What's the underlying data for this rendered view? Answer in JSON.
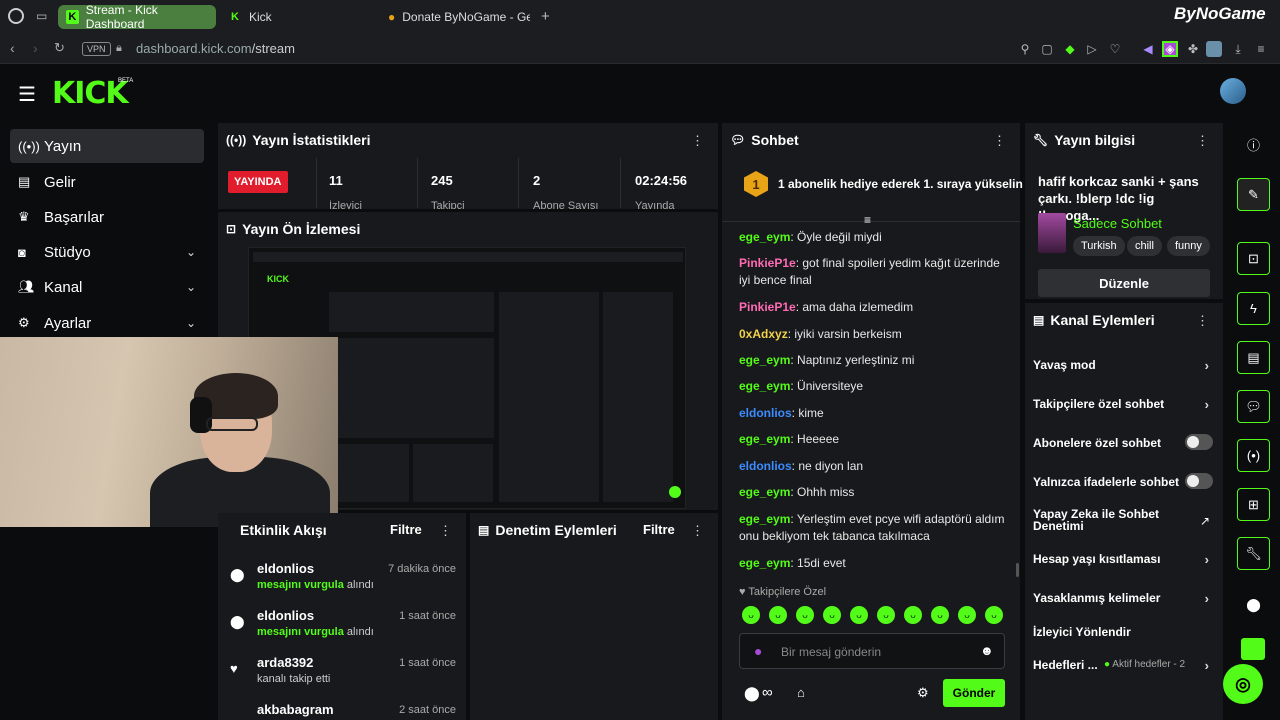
{
  "browser": {
    "tabs": [
      {
        "label": "Stream - Kick Dashboard"
      },
      {
        "label": "Kick"
      },
      {
        "label": "Donate ByNoGame - Gele"
      }
    ],
    "new_tab": "+",
    "url_host": "dashboard.kick.com",
    "url_path": "/stream",
    "vpn": "VPN"
  },
  "watermark": "ByNoGame",
  "header": {
    "logo": "KICK",
    "beta": "BETA"
  },
  "sidebar": {
    "items": [
      {
        "label": "Yayın",
        "icon": "broadcast-icon"
      },
      {
        "label": "Gelir",
        "icon": "chart-icon"
      },
      {
        "label": "Başarılar",
        "icon": "trophy-icon"
      },
      {
        "label": "Stüdyo",
        "icon": "studio-icon"
      },
      {
        "label": "Kanal",
        "icon": "users-icon"
      },
      {
        "label": "Ayarlar",
        "icon": "gear-icon"
      }
    ]
  },
  "stats": {
    "title": "Yayın İstatistikleri",
    "live_badge": "YAYINDA",
    "items": [
      {
        "value": "11",
        "label": "İzleyici"
      },
      {
        "value": "245",
        "label": "Takipçi"
      },
      {
        "value": "2",
        "label": "Abone Sayısı"
      },
      {
        "value": "02:24:56",
        "label": "Yayında"
      }
    ]
  },
  "preview": {
    "title": "Yayın Ön İzlemesi"
  },
  "activity": {
    "title": "Etkinlik Akışı",
    "filter": "Filtre",
    "items": [
      {
        "name": "eldonlios",
        "time": "7 dakika önce",
        "highlight": "mesajını vurgula",
        "rest": " alındı"
      },
      {
        "name": "eldonlios",
        "time": "1 saat önce",
        "highlight": "mesajını vurgula",
        "rest": " alındı"
      },
      {
        "name": "arda8392",
        "time": "1 saat önce",
        "highlight": "",
        "rest": "kanalı takip etti"
      },
      {
        "name": "akbabagram",
        "time": "2 saat önce",
        "highlight": "",
        "rest": ""
      }
    ]
  },
  "moderation": {
    "title": "Denetim Eylemleri",
    "filter": "Filtre"
  },
  "chat": {
    "title": "Sohbet",
    "pinned": "1 abonelik hediye ederek 1. sıraya yükselin",
    "pinned_rank": "1",
    "messages": [
      {
        "user": "ege_eym",
        "color": "#53fc18",
        "text": "Öyle değil miydi"
      },
      {
        "user": "PinkieP1e",
        "color": "#ff6bb5",
        "text": "got final spoileri yedim kağıt üzerinde iyi bence final"
      },
      {
        "user": "PinkieP1e",
        "color": "#ff6bb5",
        "text": "ama daha izlemedim"
      },
      {
        "user": "0xAdxyz",
        "color": "#f2d14a",
        "text": "iyiki varsin berkeism"
      },
      {
        "user": "ege_eym",
        "color": "#53fc18",
        "text": "Naptınız yerleştiniz mi"
      },
      {
        "user": "ege_eym",
        "color": "#53fc18",
        "text": "Üniversiteye"
      },
      {
        "user": "eldonlios",
        "color": "#3b8cff",
        "text": "kime"
      },
      {
        "user": "ege_eym",
        "color": "#53fc18",
        "text": "Heeeee"
      },
      {
        "user": "eldonlios",
        "color": "#3b8cff",
        "text": "ne diyon lan"
      },
      {
        "user": "ege_eym",
        "color": "#53fc18",
        "text": "Ohhh miss"
      },
      {
        "user": "ege_eym",
        "color": "#53fc18",
        "text": "Yerleştim evet pcye wifi adaptörü aldım onu bekliyom tek tabanca takılmaca"
      },
      {
        "user": "ege_eym",
        "color": "#53fc18",
        "text": "15di evet"
      }
    ],
    "followers_only": "Takipçilere Özel",
    "input_placeholder": "Bir mesaj gönderin",
    "send": "Gönder",
    "infinity": "∞"
  },
  "stream_info": {
    "title": "Yayın bilgisi",
    "stream_title": "hafif korkcaz sanki + şans çarkı. !blerp !dc !ig !bynoga...",
    "category": "Sadece Sohbet",
    "tags": [
      "Turkish",
      "chill",
      "funny"
    ],
    "edit": "Düzenle"
  },
  "channel_actions": {
    "title": "Kanal Eylemleri",
    "items": [
      {
        "label": "Yavaş mod",
        "kind": "chevron"
      },
      {
        "label": "Takipçilere özel sohbet",
        "kind": "chevron"
      },
      {
        "label": "Abonelere özel sohbet",
        "kind": "toggle"
      },
      {
        "label": "Yalnızca ifadelerle sohbet",
        "kind": "toggle"
      },
      {
        "label": "Yapay Zeka ile Sohbet Denetimi",
        "kind": "external"
      },
      {
        "label": "Hesap yaşı kısıtlaması",
        "kind": "chevron"
      },
      {
        "label": "Yasaklanmış kelimeler",
        "kind": "chevron"
      },
      {
        "label": "İzleyici Yönlendir",
        "kind": "none"
      },
      {
        "label": "Hedefleri ...",
        "kind": "chevron"
      }
    ],
    "goals_status": "Aktif hedefler - 2"
  },
  "colors": {
    "accent": "#53fc18",
    "live": "#e01c2d",
    "panel": "#18191c"
  }
}
